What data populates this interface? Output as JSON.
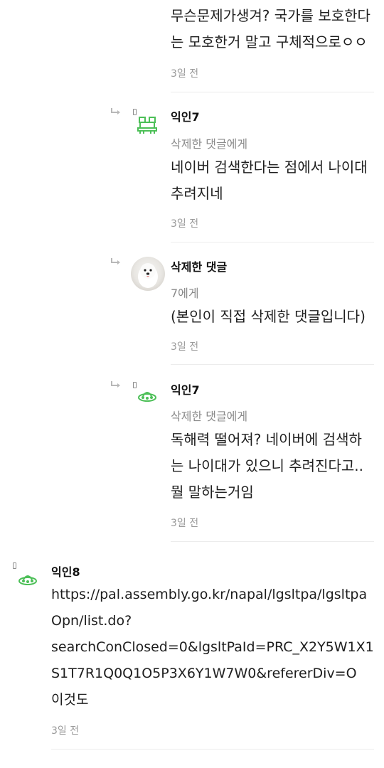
{
  "comments": [
    {
      "body": "무슨문제가생겨? 국가를 보호한다\n는 모호한거 말고 구체적으로ㅇㅇ",
      "time": "3일 전"
    },
    {
      "author": "익인7",
      "reply_to": "삭제한 댓글에게",
      "body": "네이버 검색한다는 점에서 나이대\n추려지네",
      "time": "3일 전",
      "avatar_icon": "space-invader-icon",
      "accent": "#4cbf57"
    },
    {
      "author": "삭제한 댓글",
      "reply_to": "7에게",
      "body": "(본인이 직접 삭제한 댓글입니다)",
      "time": "3일 전",
      "avatar_icon": "dog-photo-avatar"
    },
    {
      "author": "익인7",
      "reply_to": "삭제한 댓글에게",
      "body": "독해력 떨어져? 네이버에 검색하\n는 나이대가 있으니 추려진다고..\n뭘 말하는거임",
      "time": "3일 전",
      "avatar_icon": "ufo-icon",
      "accent": "#4cbf57"
    },
    {
      "author": "익인8",
      "body": "https://pal.assembly.go.kr/napal/lgsltpa/lgsltpa\nOpn/list.do?\nsearchConClosed=0&lgsltPaId=PRC_X2Y5W1X1\nS1T7R1Q0Q1O5P3X6Y1W7W0&refererDiv=O\n이것도",
      "time": "3일 전",
      "avatar_icon": "ufo-icon",
      "accent": "#4cbf57"
    }
  ]
}
